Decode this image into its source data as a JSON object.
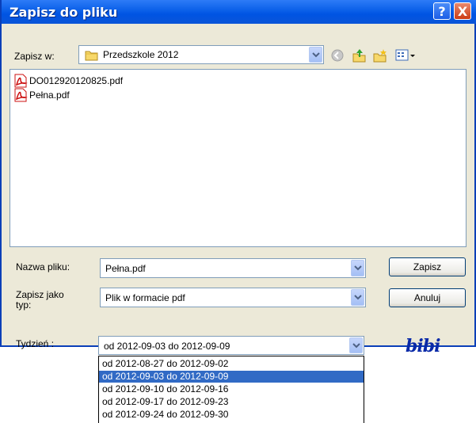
{
  "window": {
    "title": "Zapisz do pliku"
  },
  "titlebar_buttons": {
    "help": "?",
    "close": "X"
  },
  "save_in": {
    "label": "Zapisz w:",
    "value": "Przedszkole 2012"
  },
  "files": [
    {
      "name": "DO012920120825.pdf",
      "icon": "pdf-icon"
    },
    {
      "name": "Pełna.pdf",
      "icon": "pdf-icon"
    }
  ],
  "filename": {
    "label": "Nazwa pliku:",
    "value": "Pełna.pdf"
  },
  "filetype": {
    "label": "Zapisz jako typ:",
    "value": "Plik w formacie pdf"
  },
  "week": {
    "label": "Tydzień :",
    "value": "od 2012-09-03 do 2012-09-09",
    "options": [
      "od 2012-08-27 do 2012-09-02",
      "od 2012-09-03 do 2012-09-09",
      "od 2012-09-10 do 2012-09-16",
      "od 2012-09-17 do 2012-09-23",
      "od 2012-09-24 do 2012-09-30"
    ],
    "selected_index": 1
  },
  "buttons": {
    "save": "Zapisz",
    "cancel": "Anuluj"
  },
  "logo_text": "bibi",
  "colors": {
    "titlebar": "#0054e3",
    "selection": "#316ac5",
    "dialog_bg": "#ece9d8"
  }
}
